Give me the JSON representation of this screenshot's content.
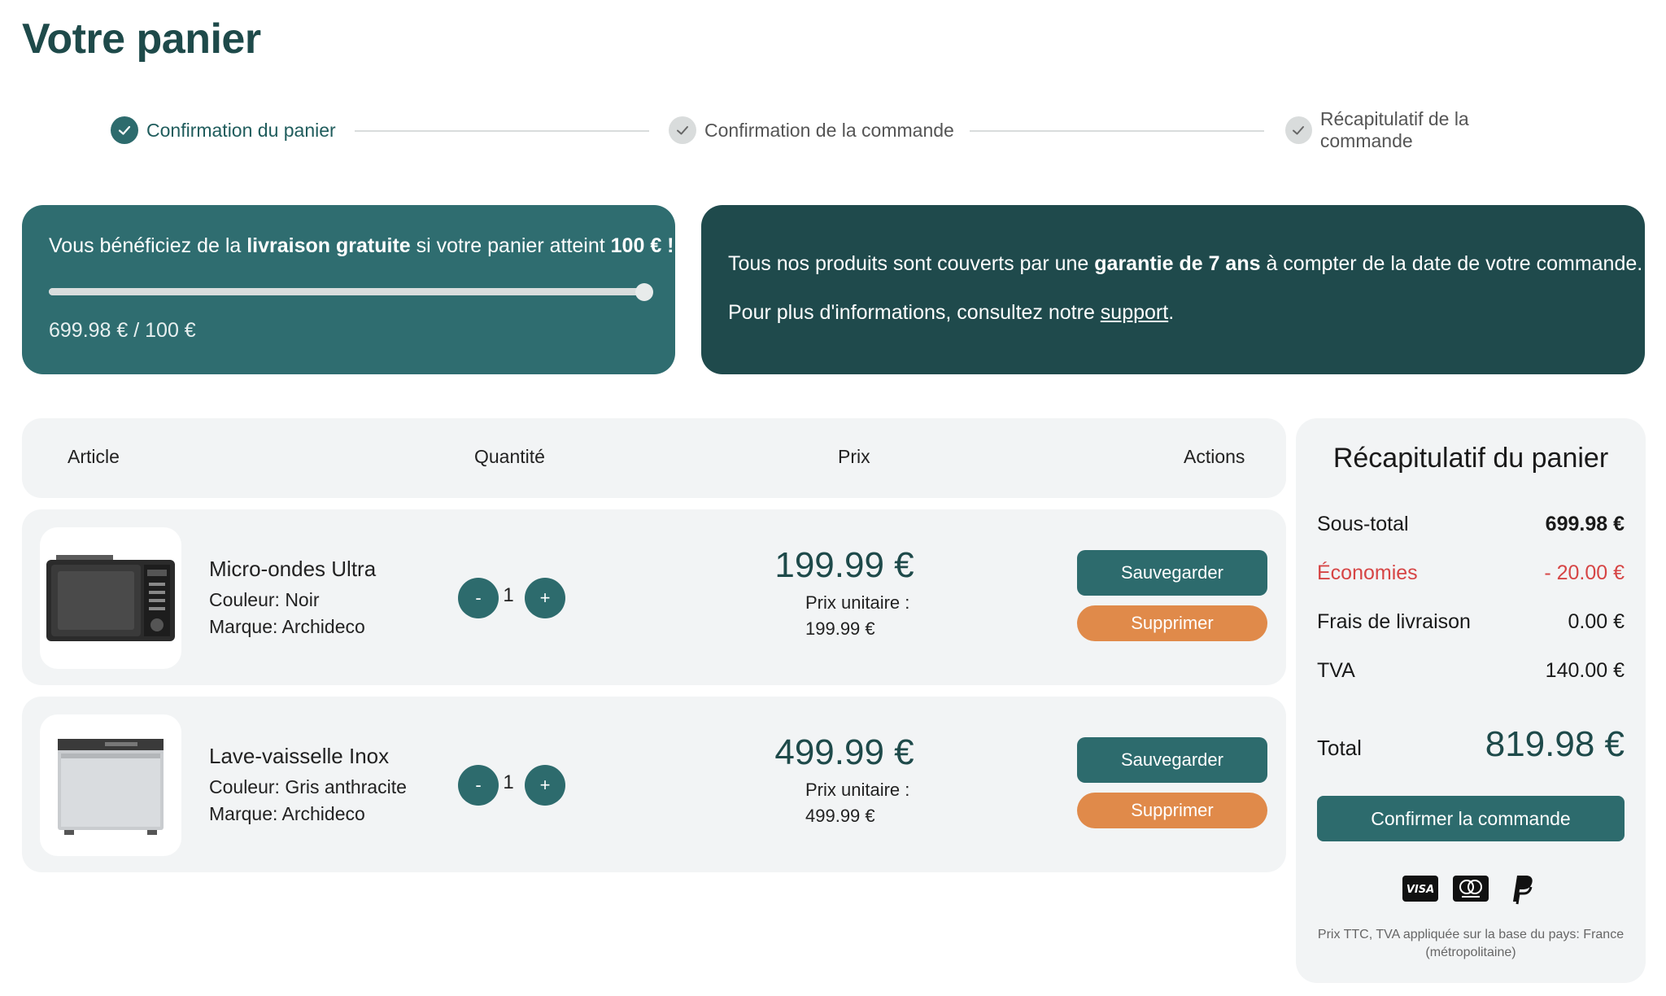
{
  "page": {
    "title": "Votre panier"
  },
  "stepper": {
    "steps": [
      {
        "label": "Confirmation du panier",
        "state": "active"
      },
      {
        "label": "Confirmation de la commande",
        "state": "inactive"
      },
      {
        "label": "Récapitulatif de la commande",
        "state": "inactive"
      }
    ]
  },
  "shipping_banner": {
    "text_before": "Vous bénéficiez de la ",
    "text_bold": "livraison gratuite",
    "text_middle": " si votre panier atteint ",
    "text_threshold": "100 € !",
    "progress_fraction": 1.0,
    "amount": "699.98 € / 100 €"
  },
  "warranty_banner": {
    "line1_before": "Tous nos produits sont couverts par une ",
    "line1_bold": "garantie de 7 ans",
    "line1_after": " à compter de la date de votre commande.",
    "line2_before": "Pour plus d'informations, consultez notre ",
    "line2_link": "support",
    "line2_after": "."
  },
  "table": {
    "headers": {
      "article": "Article",
      "quantity": "Quantité",
      "price": "Prix",
      "actions": "Actions"
    },
    "rows": [
      {
        "name": "Micro-ondes Ultra",
        "color": "Couleur: Noir",
        "brand": "Marque: Archideco",
        "quantity": "1",
        "minus": "-",
        "plus": "+",
        "price": "199.99 €",
        "unit_label": "Prix unitaire :",
        "unit_price": "199.99 €",
        "save": "Sauvegarder",
        "delete": "Supprimer",
        "image": "microwave-image"
      },
      {
        "name": "Lave-vaisselle Inox",
        "color": "Couleur: Gris anthracite",
        "brand": "Marque: Archideco",
        "quantity": "1",
        "minus": "-",
        "plus": "+",
        "price": "499.99 €",
        "unit_label": "Prix unitaire :",
        "unit_price": "499.99 €",
        "save": "Sauvegarder",
        "delete": "Supprimer",
        "image": "dishwasher-image"
      }
    ]
  },
  "summary": {
    "title": "Récapitulatif du panier",
    "subtotal_label": "Sous-total",
    "subtotal_value": "699.98 €",
    "savings_label": "Économies",
    "savings_value": "- 20.00 €",
    "shipping_label": "Frais de livraison",
    "shipping_value": "0.00 €",
    "tax_label": "TVA",
    "tax_value": "140.00 €",
    "total_label": "Total",
    "total_value": "819.98 €",
    "confirm": "Confirmer la commande",
    "payment_icons": [
      "visa-icon",
      "mastercard-icon",
      "paypal-icon"
    ],
    "note": "Prix TTC, TVA appliquée sur la base du pays: France (métropolitaine)"
  },
  "colors": {
    "brand_dark": "#1f4a4c",
    "brand": "#2d6b6d",
    "delete": "#e08a4a",
    "savings": "#d64545"
  }
}
